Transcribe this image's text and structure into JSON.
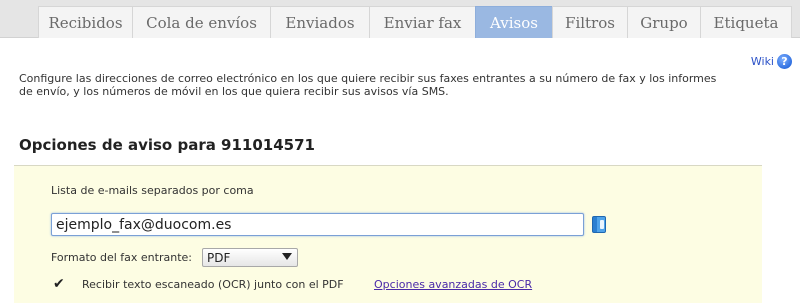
{
  "tabs": [
    {
      "label": "Recibidos"
    },
    {
      "label": "Cola de envíos"
    },
    {
      "label": "Enviados"
    },
    {
      "label": "Enviar fax"
    },
    {
      "label": "Avisos",
      "active": true
    },
    {
      "label": "Filtros"
    },
    {
      "label": "Grupo"
    },
    {
      "label": "Etiqueta"
    }
  ],
  "wiki": {
    "label": "Wiki",
    "icon": "help-icon"
  },
  "intro": "Configure las direcciones de correo electrónico en los que quiere recibir sus faxes entrantes a su número de fax y los informes de envío, y los números de móvil en los que quiera recibir sus avisos vía SMS.",
  "section_title": "Opciones de aviso para 911014571",
  "emails": {
    "label": "Lista de e-mails separados por coma",
    "value": "ejemplo_fax@duocom.es",
    "icon": "address-book-icon"
  },
  "format": {
    "label": "Formato del fax entrante:",
    "selected": "PDF"
  },
  "ocr": {
    "checked": true,
    "check_mark": "✔",
    "label": "Recibir texto escaneado (OCR) junto con el PDF",
    "link": "Opciones avanzadas de OCR"
  },
  "colors": {
    "active_tab": "#9ab8e2",
    "panel_background": "#fdfde3",
    "link": "#4a2aa8"
  }
}
